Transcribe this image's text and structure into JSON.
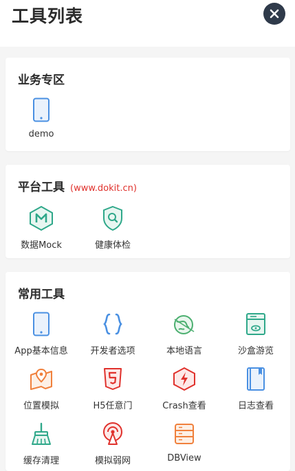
{
  "header": {
    "title": "工具列表"
  },
  "sections": [
    {
      "title": "业务专区",
      "note": "",
      "items": [
        {
          "label": "demo",
          "icon": "phone-icon"
        }
      ]
    },
    {
      "title": "平台工具",
      "note": "(www.dokit.cn)",
      "items": [
        {
          "label": "数据Mock",
          "icon": "mock-hexagon-icon"
        },
        {
          "label": "健康体检",
          "icon": "health-shield-icon"
        }
      ]
    },
    {
      "title": "常用工具",
      "note": "",
      "items": [
        {
          "label": "App基本信息",
          "icon": "phone-icon"
        },
        {
          "label": "开发者选项",
          "icon": "code-braces-icon"
        },
        {
          "label": "本地语言",
          "icon": "globe-icon"
        },
        {
          "label": "沙盒游览",
          "icon": "sandbox-icon"
        },
        {
          "label": "位置模拟",
          "icon": "map-pin-icon"
        },
        {
          "label": "H5任意门",
          "icon": "html5-icon"
        },
        {
          "label": "Crash查看",
          "icon": "crash-icon"
        },
        {
          "label": "日志查看",
          "icon": "log-book-icon"
        },
        {
          "label": "缓存清理",
          "icon": "broom-icon"
        },
        {
          "label": "模拟弱网",
          "icon": "weak-network-icon"
        },
        {
          "label": "DBView",
          "icon": "database-icon"
        }
      ]
    }
  ],
  "colors": {
    "blue": "#4a90e2",
    "green": "#2fa88a",
    "orange": "#f0803c",
    "red": "#e0312c",
    "dark": "#2f3a4a"
  }
}
